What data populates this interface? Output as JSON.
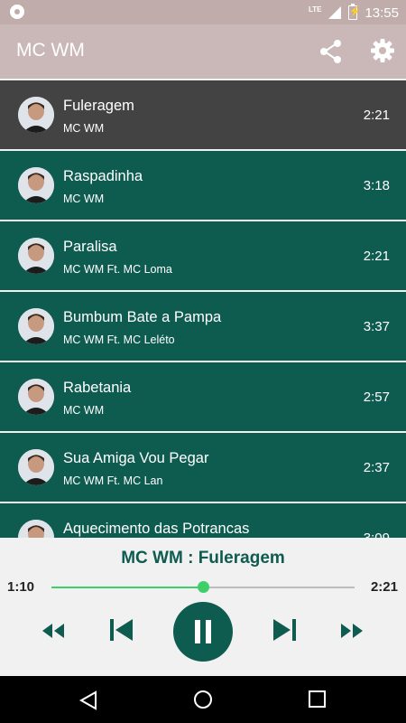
{
  "status_bar": {
    "time": "13:55",
    "network": "LTE",
    "battery_charging": "⚡"
  },
  "app_bar": {
    "title": "MC WM"
  },
  "songs": [
    {
      "title": "Fuleragem",
      "artist": "MC WM",
      "duration": "2:21",
      "active": true
    },
    {
      "title": "Raspadinha",
      "artist": "MC WM",
      "duration": "3:18"
    },
    {
      "title": "Paralisa",
      "artist": "MC WM Ft. MC Loma",
      "duration": "2:21"
    },
    {
      "title": "Bumbum Bate a Pampa",
      "artist": "MC WM Ft. MC Leléto",
      "duration": "3:37"
    },
    {
      "title": "Rabetania",
      "artist": "MC WM",
      "duration": "2:57"
    },
    {
      "title": "Sua Amiga Vou Pegar",
      "artist": "MC WM Ft. MC Lan",
      "duration": "2:37"
    },
    {
      "title": "Aquecimento das Potrancas",
      "artist": "",
      "duration": "3:09"
    }
  ],
  "player": {
    "now_playing": "MC WM : Fuleragem",
    "elapsed": "1:10",
    "total": "2:21",
    "progress": 0.5
  },
  "colors": {
    "accent": "#0e5b50",
    "active_row": "#434343",
    "app_bar": "#c9b8b7",
    "seek": "#3ecf6b"
  },
  "icons": {
    "share": "share-icon",
    "settings": "gear-icon",
    "rewind": "fast-rewind-icon",
    "previous": "skip-previous-icon",
    "pause": "pause-icon",
    "next": "skip-next-icon",
    "forward": "fast-forward-icon",
    "back": "back-triangle-icon",
    "home": "home-circle-icon",
    "recents": "recents-square-icon"
  }
}
